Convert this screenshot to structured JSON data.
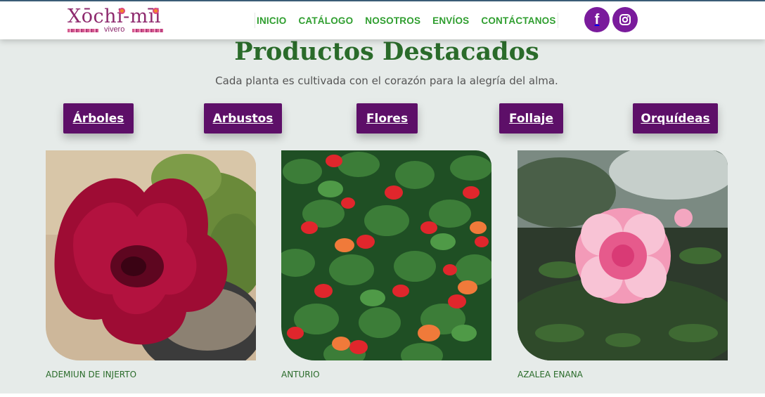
{
  "header": {
    "logo": {
      "word": "Xōchi-mīl",
      "sub": "vivero"
    },
    "nav": [
      "INICIO",
      "CATÁLOGO",
      "NOSOTROS",
      "ENVÍOS",
      "CONTÁCTANOS"
    ],
    "social": [
      {
        "icon": "facebook-icon",
        "glyph": "f"
      },
      {
        "icon": "instagram-icon"
      }
    ]
  },
  "main": {
    "title": "Productos Destacados",
    "subtitle": "Cada planta es cultivada con el corazón para la alegría del alma.",
    "categories": [
      "Árboles",
      "Arbustos",
      "Flores",
      "Follaje",
      "Orquídeas"
    ],
    "products": [
      {
        "name": "ADEMIUN DE INJERTO",
        "image": "red-adenium-flower"
      },
      {
        "name": "ANTURIO",
        "image": "red-anthurium-plants"
      },
      {
        "name": "AZALEA ENANA",
        "image": "pink-azalea-flower"
      }
    ]
  },
  "colors": {
    "brand_purple": "#5d0f68",
    "nav_green": "#2f9e2f",
    "title_green": "#2a6b2a",
    "social_purple": "#7a1b9c",
    "background": "#e6ebe9"
  }
}
